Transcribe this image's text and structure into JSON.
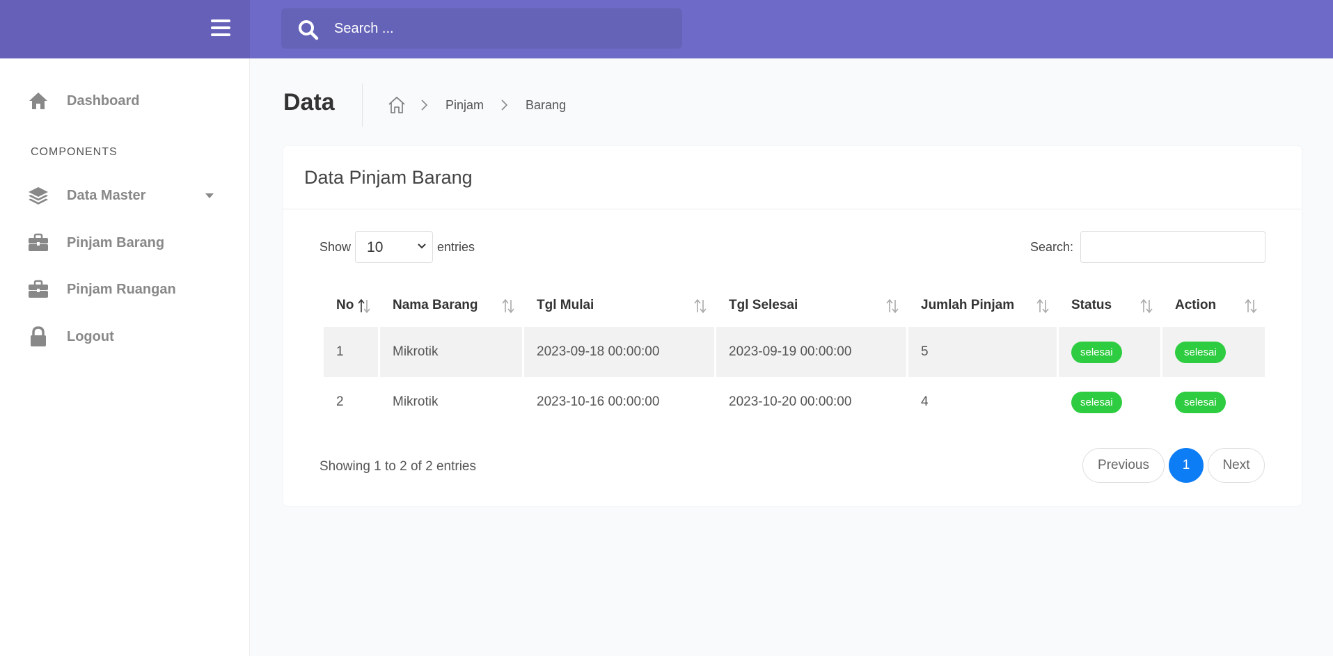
{
  "header": {
    "search_placeholder": "Search ..."
  },
  "sidebar": {
    "items": [
      {
        "label": "Dashboard",
        "icon": "home-icon"
      },
      {
        "label": "Data Master",
        "icon": "layers-icon"
      },
      {
        "label": "Pinjam Barang",
        "icon": "briefcase-icon"
      },
      {
        "label": "Pinjam Ruangan",
        "icon": "briefcase-icon"
      },
      {
        "label": "Logout",
        "icon": "lock-icon"
      }
    ],
    "section_label": "COMPONENTS"
  },
  "page": {
    "title": "Data",
    "breadcrumb": [
      "Pinjam",
      "Barang"
    ]
  },
  "card": {
    "title": "Data Pinjam Barang",
    "length_prefix": "Show",
    "length_value": "10",
    "length_suffix": "entries",
    "search_label": "Search:",
    "columns": [
      "No",
      "Nama Barang",
      "Tgl Mulai",
      "Tgl Selesai",
      "Jumlah Pinjam",
      "Status",
      "Action"
    ],
    "rows": [
      {
        "no": "1",
        "nama": "Mikrotik",
        "mulai": "2023-09-18 00:00:00",
        "selesai": "2023-09-19 00:00:00",
        "jumlah": "5",
        "status": "selesai",
        "action": "selesai"
      },
      {
        "no": "2",
        "nama": "Mikrotik",
        "mulai": "2023-10-16 00:00:00",
        "selesai": "2023-10-20 00:00:00",
        "jumlah": "4",
        "status": "selesai",
        "action": "selesai"
      }
    ],
    "info": "Showing 1 to 2 of 2 entries",
    "pager": {
      "prev": "Previous",
      "current": "1",
      "next": "Next"
    }
  },
  "colors": {
    "topbar": "#6e6ac8",
    "badge": "#2ecc40",
    "pager_active": "#0d7df5"
  }
}
